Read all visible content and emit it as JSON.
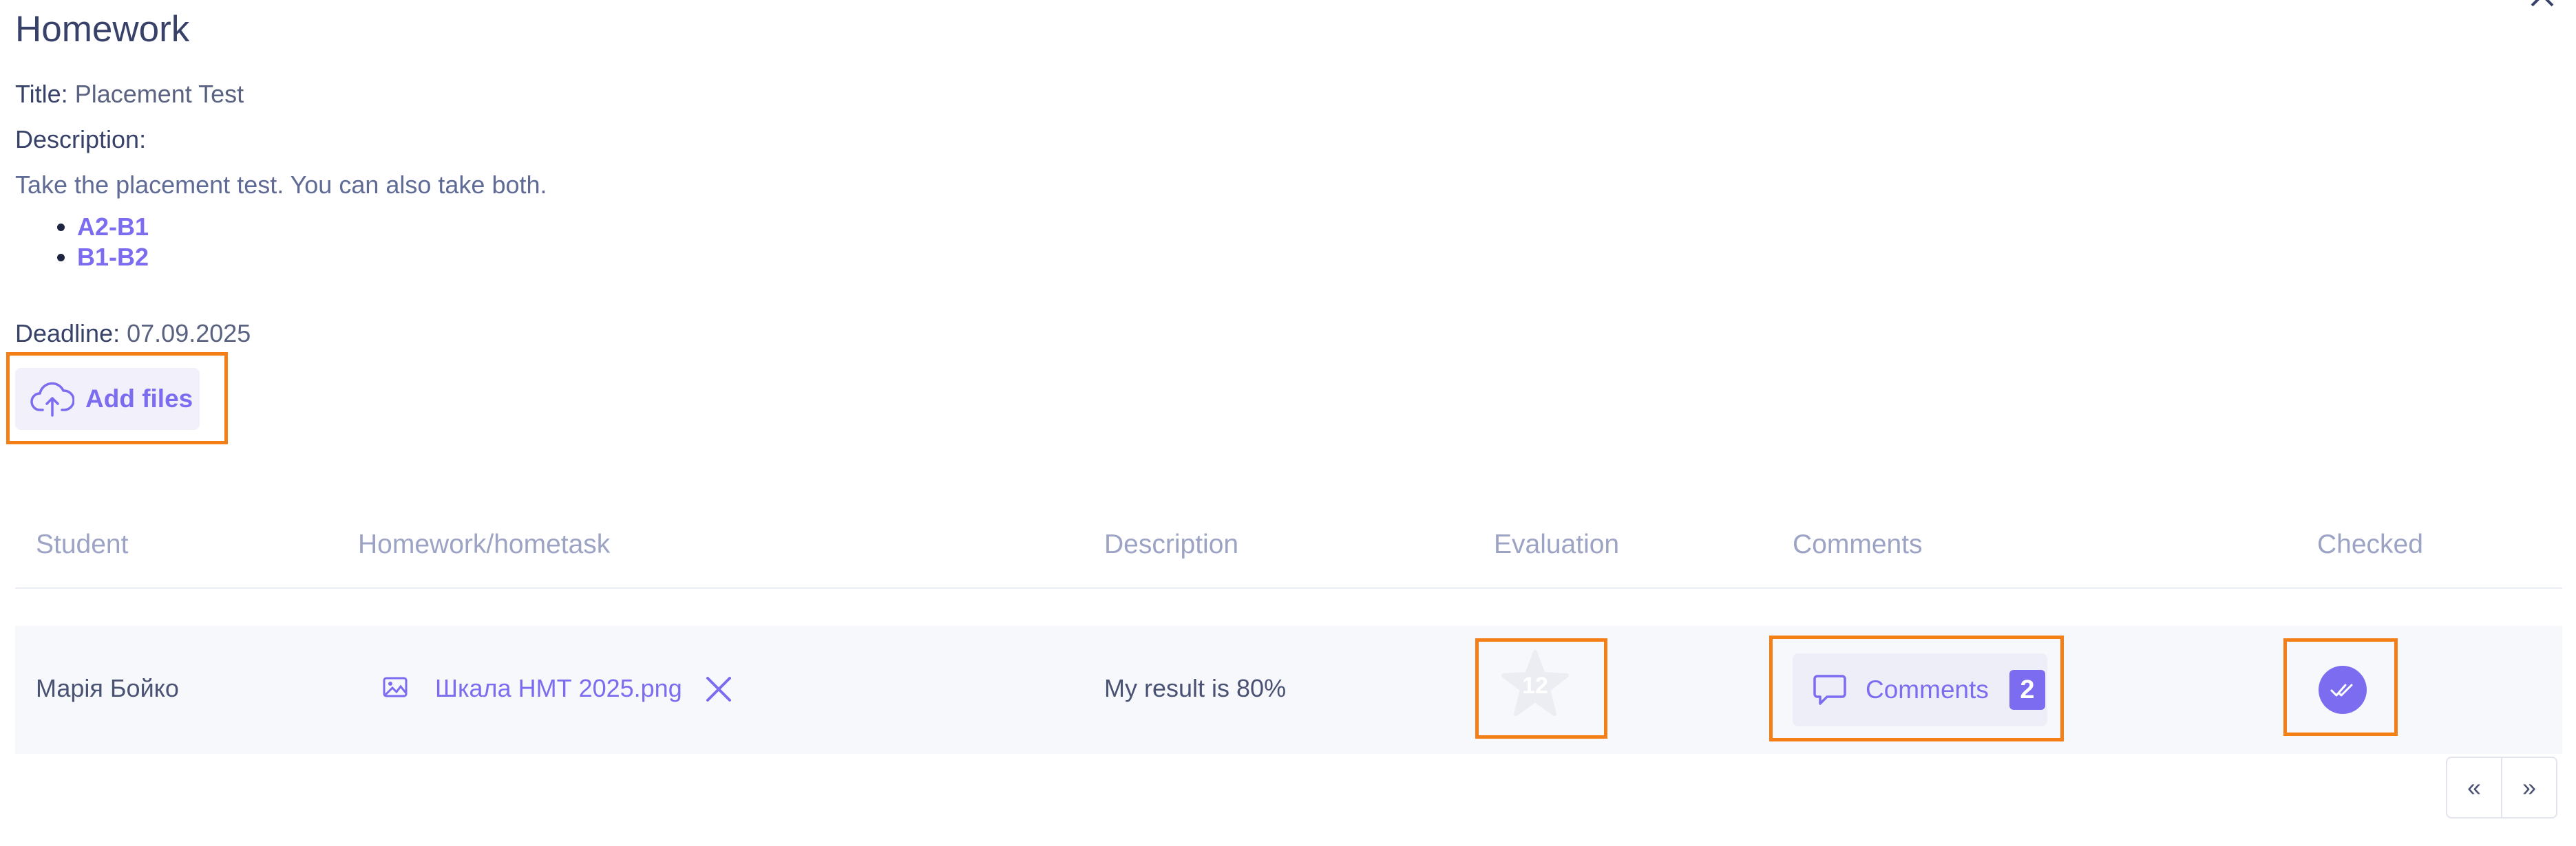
{
  "modal": {
    "title": "Homework",
    "title_label": "Title:",
    "title_value": "Placement Test",
    "description_label": "Description:",
    "description_text": "Take the placement test. You can also take both.",
    "links": [
      "A2-B1",
      "B1-B2"
    ],
    "deadline_label": "Deadline:",
    "deadline_value": "07.09.2025",
    "add_files_label": "Add files",
    "close_icon": "close-icon"
  },
  "table": {
    "headers": [
      "Student",
      "Homework/hometask",
      "Description",
      "Evaluation",
      "Comments",
      "Checked"
    ],
    "rows": [
      {
        "student": "Марія Бойко",
        "file_name": "Шкала НМТ 2025.png",
        "file_icon": "image-icon",
        "remove_icon": "close-icon",
        "description": "My result is 80%",
        "evaluation": "12",
        "evaluation_icon": "star-icon",
        "comments_label": "Comments",
        "comments_count": "2",
        "comments_icon": "speech-bubble-icon",
        "checked_icon": "double-check-icon"
      }
    ]
  },
  "pagination": {
    "prev": "«",
    "next": "»"
  },
  "colors": {
    "accent": "#7b6cf0",
    "highlight": "#f57f17",
    "heading": "#384269"
  }
}
